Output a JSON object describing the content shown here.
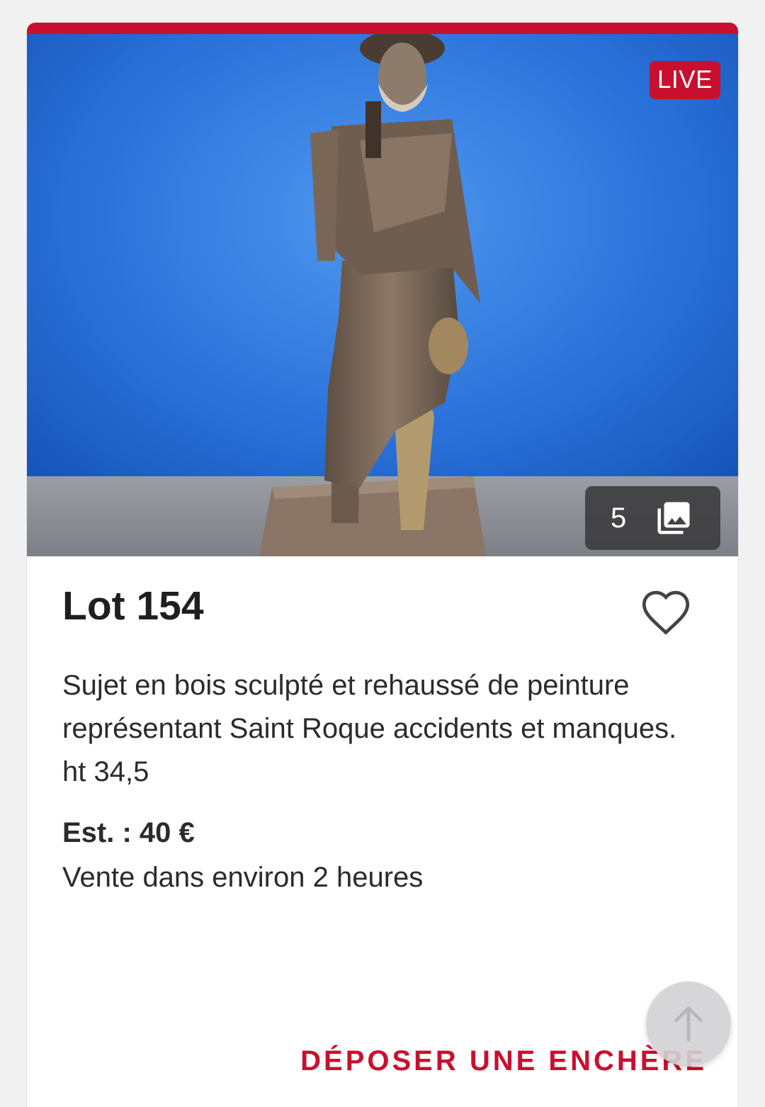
{
  "card": {
    "live_badge": "LIVE",
    "gallery": {
      "count": "5",
      "icon": "photo-library-icon"
    },
    "lot_title": "Lot 154",
    "favorite_icon": "heart-outline-icon",
    "description": "Sujet en bois sculpté et rehaussé de peinture représentant Saint Roque accidents et manques. ht 34,5",
    "estimate": "Est. : 40 €",
    "sale_time": "Vente dans environ 2 heures",
    "bid_button": "DÉPOSER UNE ENCHÈRE"
  },
  "scroll_top_icon": "arrow-up-icon",
  "colors": {
    "accent": "#c8102e",
    "photo_background": "#1a5fc7"
  }
}
